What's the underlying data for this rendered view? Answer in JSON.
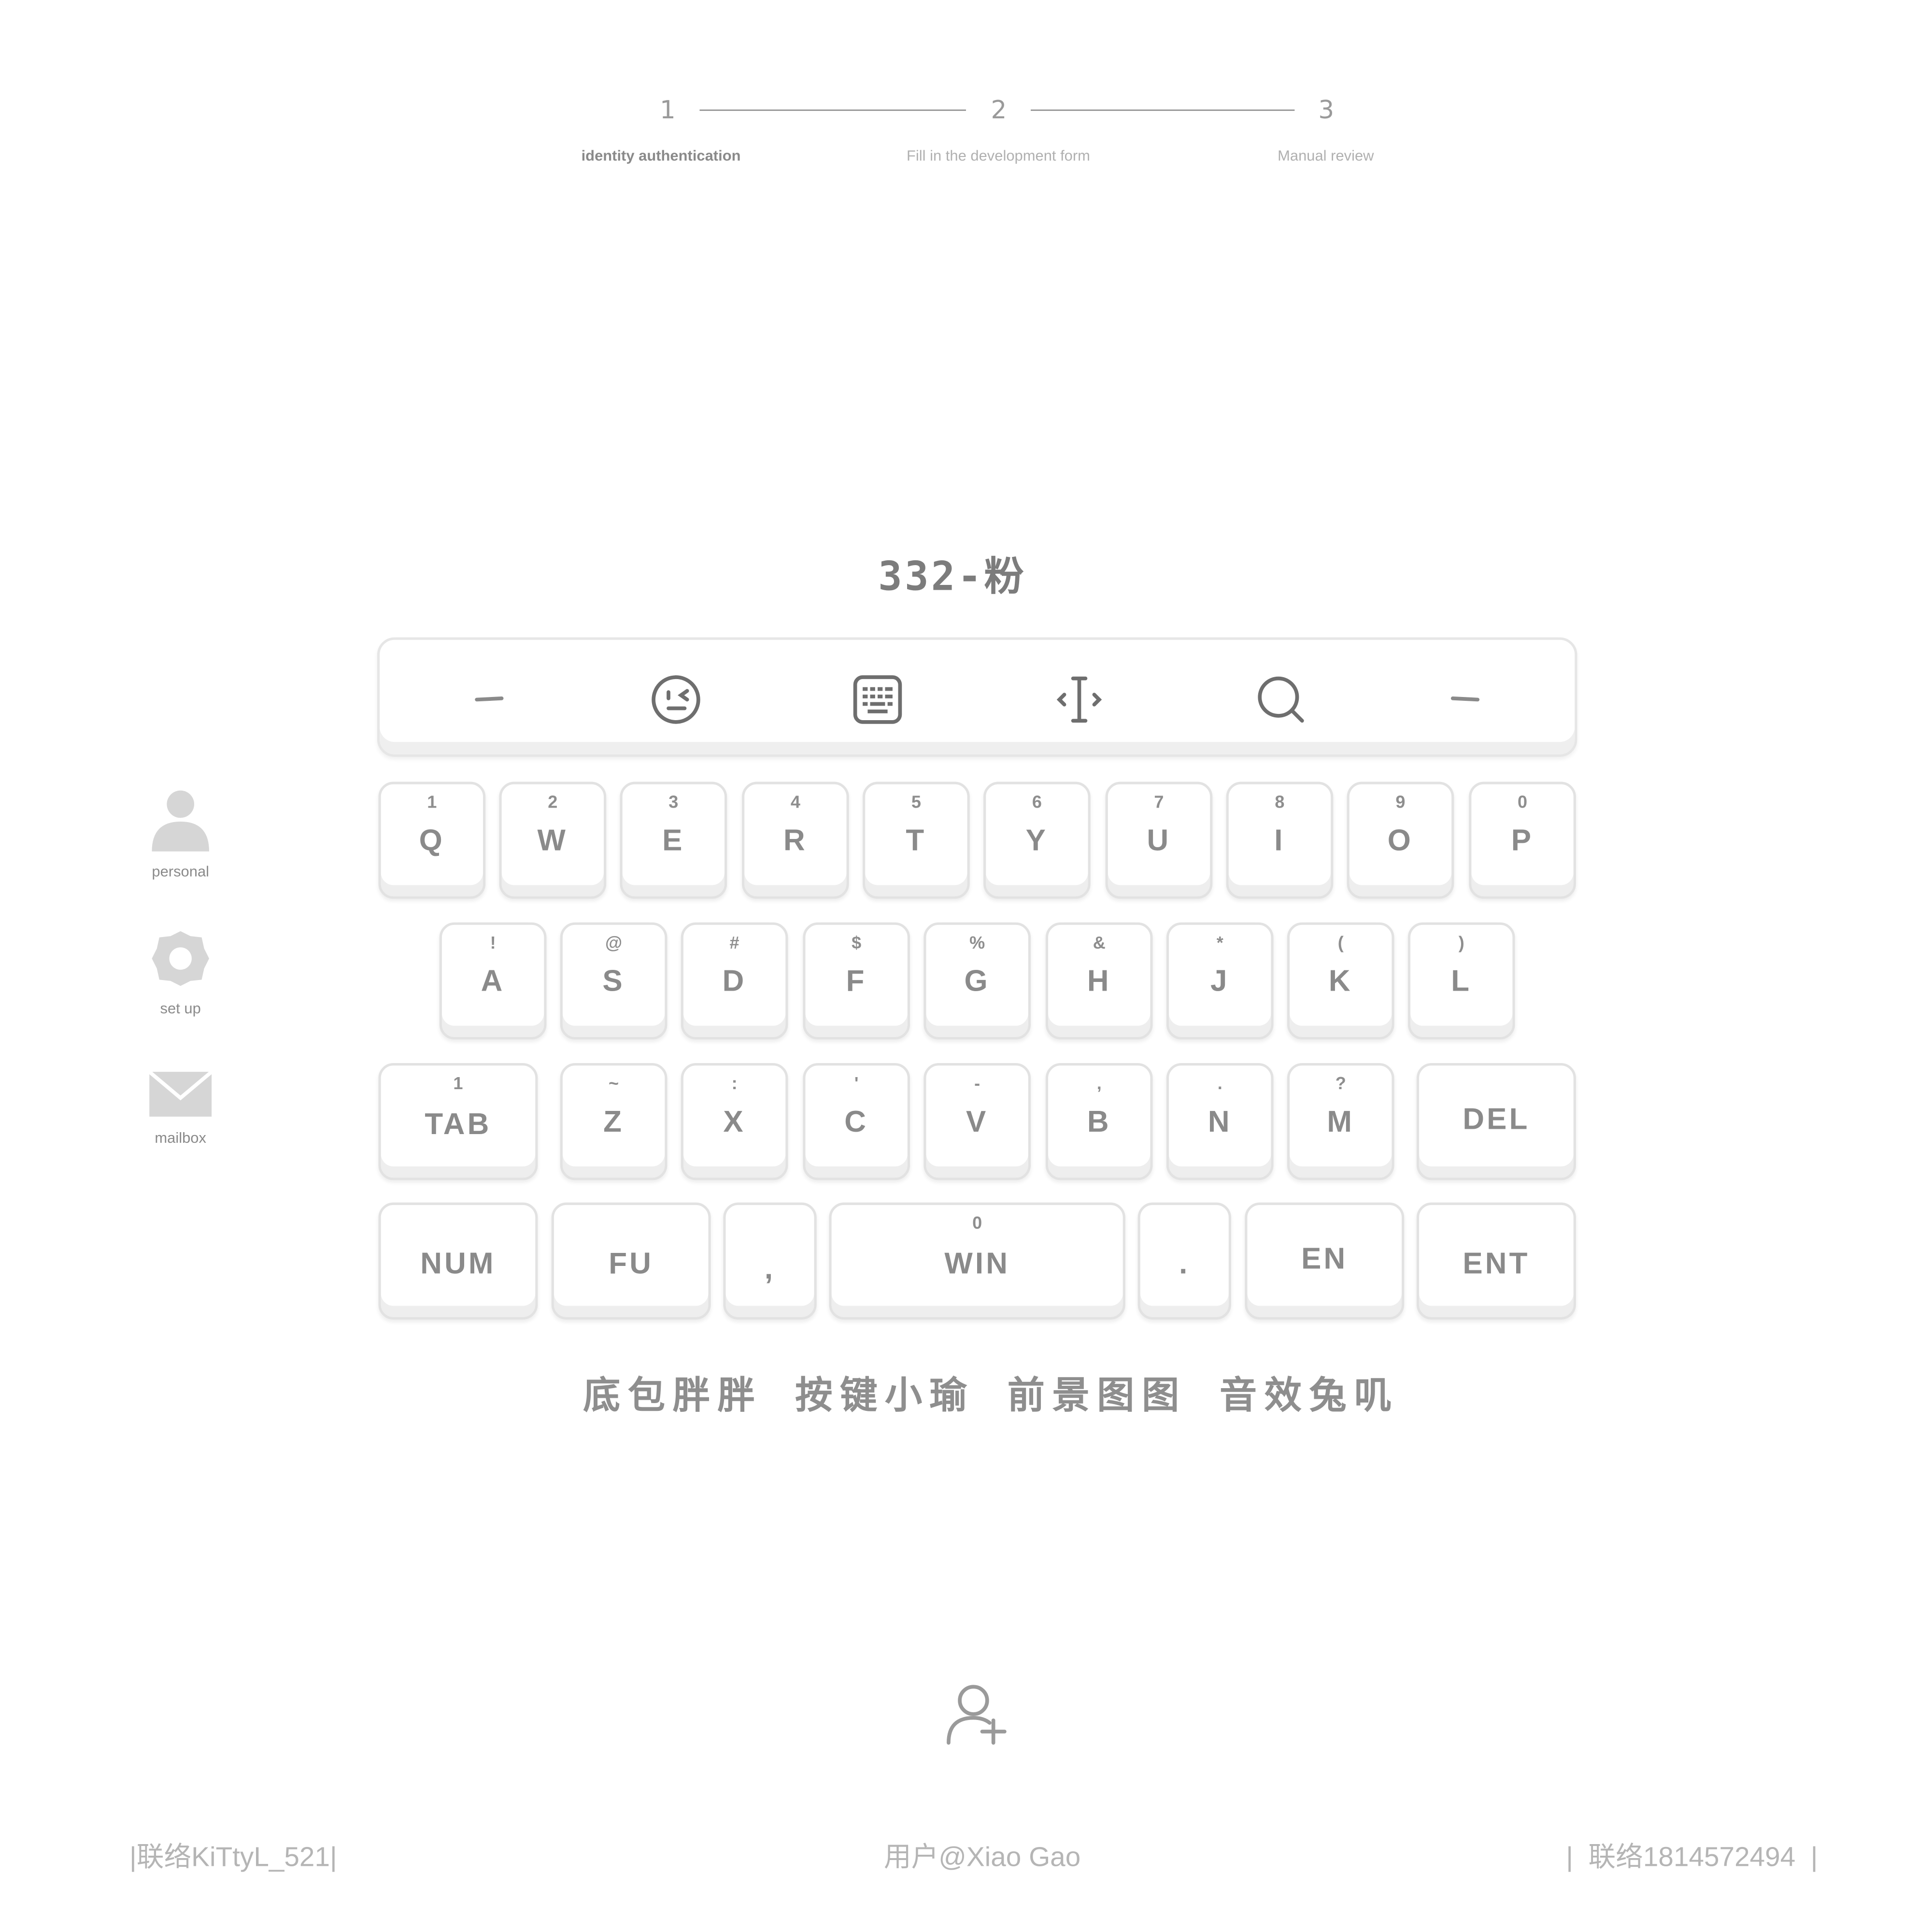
{
  "stepper": {
    "steps": [
      {
        "number": "1",
        "label": "identity authentication"
      },
      {
        "number": "2",
        "label": "Fill in the development form"
      },
      {
        "number": "3",
        "label": "Manual review"
      }
    ]
  },
  "sidebar": {
    "items": [
      {
        "label": "personal",
        "icon": "person-icon"
      },
      {
        "label": "set up",
        "icon": "gear-icon"
      },
      {
        "label": "mailbox",
        "icon": "mail-icon"
      }
    ]
  },
  "title": "332-粉",
  "toolbar": {
    "icons": [
      "dash-icon",
      "emoji-icon",
      "keyboard-icon",
      "cursor-icon",
      "search-icon",
      "dash-icon"
    ]
  },
  "keyboard": {
    "row1": [
      {
        "sub": "1",
        "main": "Q"
      },
      {
        "sub": "2",
        "main": "W"
      },
      {
        "sub": "3",
        "main": "E"
      },
      {
        "sub": "4",
        "main": "R"
      },
      {
        "sub": "5",
        "main": "T"
      },
      {
        "sub": "6",
        "main": "Y"
      },
      {
        "sub": "7",
        "main": "U"
      },
      {
        "sub": "8",
        "main": "I"
      },
      {
        "sub": "9",
        "main": "O"
      },
      {
        "sub": "0",
        "main": "P"
      }
    ],
    "row2": [
      {
        "sub": "!",
        "main": "A"
      },
      {
        "sub": "@",
        "main": "S"
      },
      {
        "sub": "#",
        "main": "D"
      },
      {
        "sub": "$",
        "main": "F"
      },
      {
        "sub": "%",
        "main": "G"
      },
      {
        "sub": "&",
        "main": "H"
      },
      {
        "sub": "*",
        "main": "J"
      },
      {
        "sub": "(",
        "main": "K"
      },
      {
        "sub": ")",
        "main": "L"
      }
    ],
    "row3": [
      {
        "sub": "1",
        "main": "TAB"
      },
      {
        "sub": "~",
        "main": "Z"
      },
      {
        "sub": ":",
        "main": "X"
      },
      {
        "sub": "'",
        "main": "C"
      },
      {
        "sub": "-",
        "main": "V"
      },
      {
        "sub": ",",
        "main": "B"
      },
      {
        "sub": ".",
        "main": "N"
      },
      {
        "sub": "?",
        "main": "M"
      },
      {
        "sub": "",
        "main": "DEL"
      }
    ],
    "row4": [
      {
        "sub": "",
        "main": "NUM"
      },
      {
        "sub": "",
        "main": "FU"
      },
      {
        "sub": "",
        "main": ","
      },
      {
        "sub": "0",
        "main": "WIN"
      },
      {
        "sub": "",
        "main": "."
      },
      {
        "sub": "",
        "main": "EN"
      },
      {
        "sub": "",
        "main": "ENT"
      }
    ]
  },
  "credits": "底包胖胖 按键小瑜 前景图图 音效兔叽",
  "add_user_icon": "add-user-icon",
  "footer": {
    "left": "|联络KiTtyL_521|",
    "center": "用户@Xiao Gao",
    "right": "|  联络1814572494  |"
  },
  "colors": {
    "background": "#ffffff",
    "text": "#8a8a8a",
    "key_border": "#e2e2e2",
    "icon": "#d4d4d4"
  }
}
